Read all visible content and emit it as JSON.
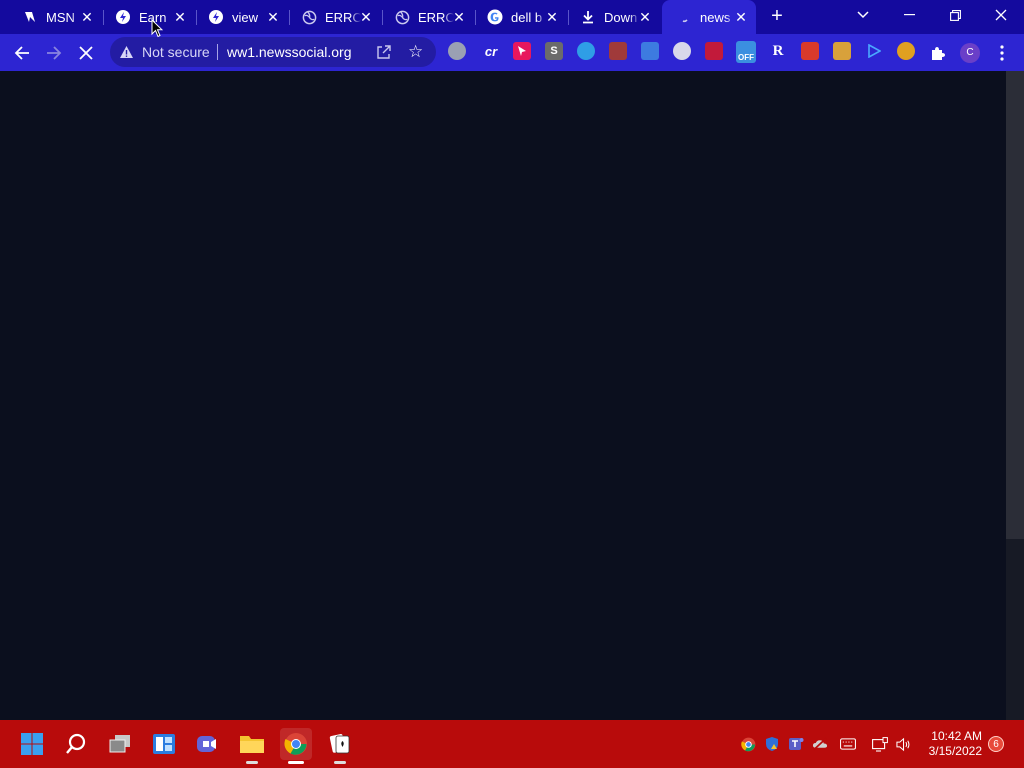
{
  "browser": {
    "tabs": [
      {
        "title": "MSN",
        "icon": "msn-icon"
      },
      {
        "title": "Earn",
        "icon": "earn-icon"
      },
      {
        "title": "view",
        "icon": "view-icon"
      },
      {
        "title": "ERRO",
        "icon": "globe-icon"
      },
      {
        "title": "ERRO",
        "icon": "globe-icon"
      },
      {
        "title": "dell b",
        "icon": "google-icon"
      },
      {
        "title": "Down",
        "icon": "download-icon"
      },
      {
        "title": "news",
        "icon": "loading-icon",
        "active": true
      }
    ],
    "close_glyph": "✕",
    "new_tab_glyph": "+",
    "omnibox": {
      "security_label": "Not secure",
      "url": "ww1.newssocial.org"
    },
    "extensions": [
      {
        "icon": "extension-elephant-icon",
        "color": "#9aa0b3"
      },
      {
        "icon": "extension-cr-icon",
        "label": "cr",
        "color": "#2d25d2"
      },
      {
        "icon": "extension-cursor-icon",
        "color": "#e8175d"
      },
      {
        "icon": "extension-s-icon",
        "label": "S",
        "color": "#6b6b6b"
      },
      {
        "icon": "extension-edge-icon",
        "color": "#2f9ee6"
      },
      {
        "icon": "extension-screen-icon",
        "color": "#a03a3a"
      },
      {
        "icon": "extension-grid-icon",
        "color": "#3d7be0"
      },
      {
        "icon": "extension-circle-icon",
        "color": "#d8d8ea"
      },
      {
        "icon": "extension-video-icon",
        "color": "#c21a3a"
      },
      {
        "icon": "extension-off-icon",
        "label": "OFF",
        "color": "#3b8fe0"
      },
      {
        "icon": "extension-r-icon",
        "label": "R",
        "color": "#2d25d2"
      },
      {
        "icon": "extension-red-icon",
        "color": "#d93a2b"
      },
      {
        "icon": "extension-face-icon",
        "color": "#d8a13b"
      },
      {
        "icon": "extension-play-icon",
        "color": "#2d25d2"
      },
      {
        "icon": "extension-monkey-icon",
        "color": "#e0a020"
      }
    ],
    "profile_initial": "C"
  },
  "taskbar": {
    "clock_time": "10:42 AM",
    "clock_date": "3/15/2022",
    "notification_count": "6"
  }
}
